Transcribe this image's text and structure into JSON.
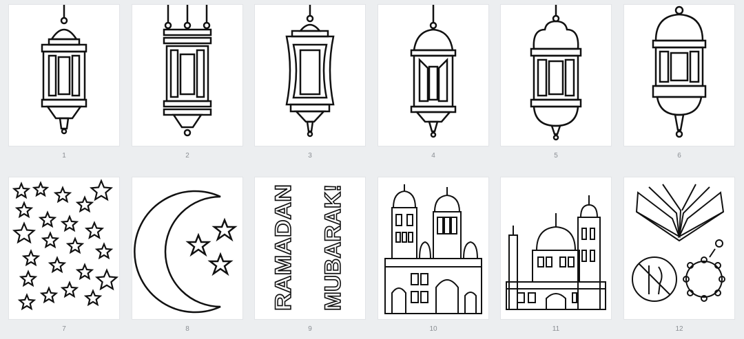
{
  "pages": [
    {
      "number": "1",
      "subject": "lantern-icon"
    },
    {
      "number": "2",
      "subject": "lantern-icon"
    },
    {
      "number": "3",
      "subject": "lantern-icon"
    },
    {
      "number": "4",
      "subject": "lantern-icon"
    },
    {
      "number": "5",
      "subject": "lantern-icon"
    },
    {
      "number": "6",
      "subject": "lantern-icon"
    },
    {
      "number": "7",
      "subject": "stars-icon"
    },
    {
      "number": "8",
      "subject": "crescent-moon-icon"
    },
    {
      "number": "9",
      "subject": "text",
      "words": [
        "RAMADAN",
        "MUBARAK!"
      ]
    },
    {
      "number": "10",
      "subject": "mosque-icon"
    },
    {
      "number": "11",
      "subject": "mosque-icon"
    },
    {
      "number": "12",
      "subject": "quran-icon"
    }
  ],
  "colors": {
    "background": "#eceef0",
    "page": "#ffffff",
    "line": "#111111",
    "page_number": "#8a8e93"
  }
}
